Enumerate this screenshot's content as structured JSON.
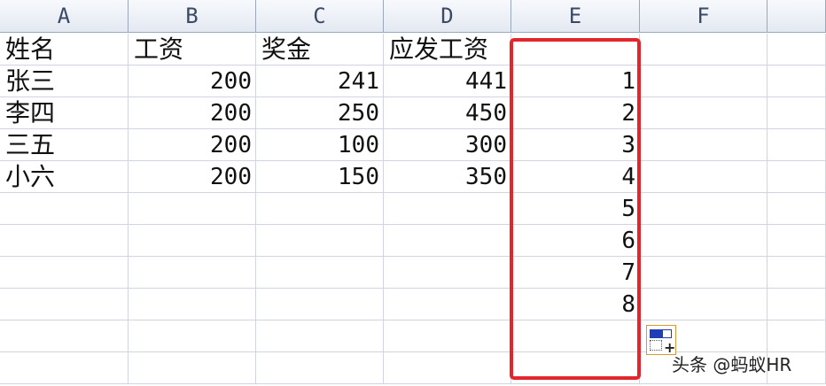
{
  "columns": [
    "A",
    "B",
    "C",
    "D",
    "E",
    "F",
    ""
  ],
  "rows": [
    [
      "姓名",
      "工资",
      "奖金",
      "应发工资",
      "",
      ""
    ],
    [
      "张三",
      "200",
      "241",
      "441",
      "1",
      ""
    ],
    [
      "李四",
      "200",
      "250",
      "450",
      "2",
      ""
    ],
    [
      "三五",
      "200",
      "100",
      "300",
      "3",
      ""
    ],
    [
      "小六",
      "200",
      "150",
      "350",
      "4",
      ""
    ],
    [
      "",
      "",
      "",
      "",
      "5",
      ""
    ],
    [
      "",
      "",
      "",
      "",
      "6",
      ""
    ],
    [
      "",
      "",
      "",
      "",
      "7",
      ""
    ],
    [
      "",
      "",
      "",
      "",
      "8",
      ""
    ],
    [
      "",
      "",
      "",
      "",
      "",
      ""
    ],
    [
      "",
      "",
      "",
      "",
      "",
      ""
    ]
  ],
  "highlight_color": "#e3262c",
  "autofill_icon": "auto-fill-options-icon",
  "watermark": "头条 @蚂蚁HR"
}
